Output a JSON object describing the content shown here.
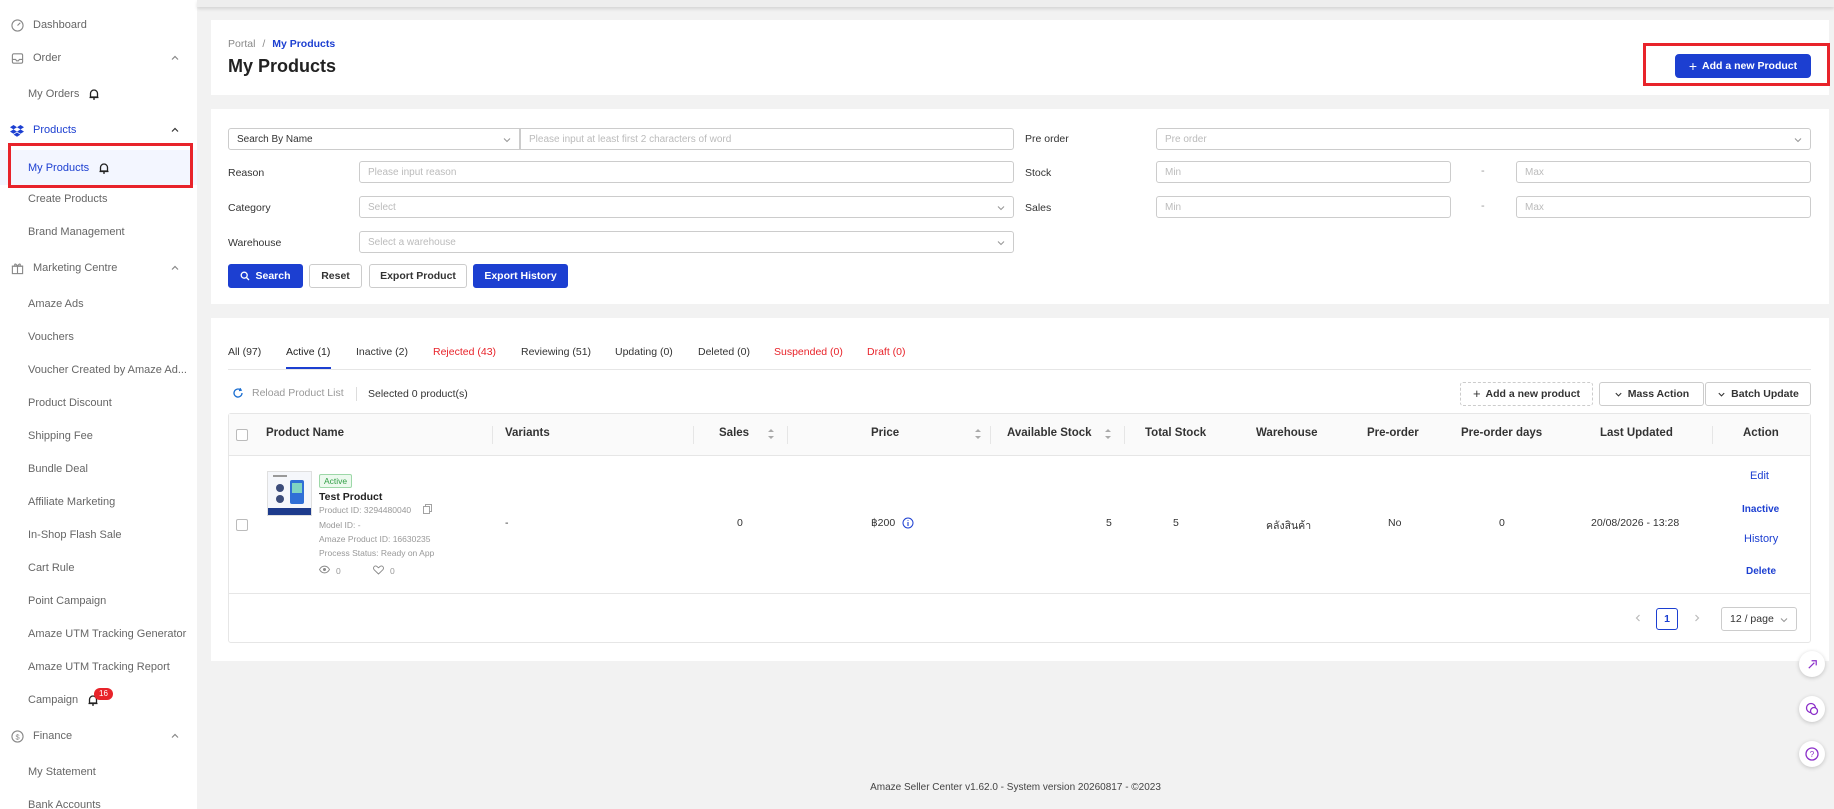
{
  "sidebar": {
    "dashboard": "Dashboard",
    "order": "Order",
    "my_orders": "My Orders",
    "products": "Products",
    "my_products": "My Products",
    "create_products": "Create Products",
    "brand_management": "Brand Management",
    "marketing_centre": "Marketing Centre",
    "marketing_items": [
      "Amaze Ads",
      "Vouchers",
      "Voucher Created by Amaze Ad...",
      "Product Discount",
      "Shipping Fee",
      "Bundle Deal",
      "Affiliate Marketing",
      "In-Shop Flash Sale",
      "Cart Rule",
      "Point Campaign",
      "Amaze UTM Tracking Generator",
      "Amaze UTM Tracking Report"
    ],
    "campaign": "Campaign",
    "campaign_badge": "16",
    "finance": "Finance",
    "my_statement": "My Statement",
    "bank_accounts": "Bank Accounts"
  },
  "header": {
    "breadcrumb_root": "Portal",
    "breadcrumb_sep": "/",
    "breadcrumb_current": "My Products",
    "title": "My Products",
    "add_button": "Add a new Product"
  },
  "filters": {
    "search_by": "Search By Name",
    "search_placeholder": "Please input at least first 2 characters of word",
    "pre_order_label": "Pre order",
    "pre_order_placeholder": "Pre order",
    "reason_label": "Reason",
    "reason_placeholder": "Please input reason",
    "stock_label": "Stock",
    "min_placeholder": "Min",
    "max_placeholder": "Max",
    "range_sep": "-",
    "category_label": "Category",
    "category_placeholder": "Select",
    "sales_label": "Sales",
    "warehouse_label": "Warehouse",
    "warehouse_placeholder": "Select a warehouse",
    "search_button": "Search",
    "reset_button": "Reset",
    "export_product_button": "Export Product",
    "export_history_button": "Export History"
  },
  "tabs": [
    "All (97)",
    "Active (1)",
    "Inactive (2)",
    "Rejected (43)",
    "Reviewing (51)",
    "Updating (0)",
    "Deleted (0)",
    "Suspended (0)",
    "Draft (0)"
  ],
  "toolbar": {
    "reload": "Reload Product List",
    "selected": "Selected 0 product(s)",
    "add_product": "Add a new product",
    "mass_action": "Mass Action",
    "batch_update": "Batch Update"
  },
  "table": {
    "headers": [
      "Product Name",
      "Variants",
      "Sales",
      "Price",
      "Available Stock",
      "Total Stock",
      "Warehouse",
      "Pre-order",
      "Pre-order days",
      "Last Updated",
      "Action"
    ],
    "row": {
      "status": "Active",
      "name": "Test Product",
      "product_id": "Product ID: 3294480040",
      "model_id": "Model ID: -",
      "amaze_id": "Amaze Product ID: 16630235",
      "process_status": "Process Status: Ready on App",
      "views": "0",
      "likes": "0",
      "variants": "-",
      "sales": "0",
      "price": "฿200",
      "available_stock": "5",
      "total_stock": "5",
      "warehouse": "คลังสินค้า",
      "pre_order": "No",
      "pre_order_days": "0",
      "last_updated": "20/08/2026 - 13:28",
      "actions": [
        "Edit",
        "Inactive",
        "History",
        "Delete"
      ]
    }
  },
  "pagination": {
    "current_page": "1",
    "page_size": "12 / page"
  },
  "footer": "Amaze Seller Center v1.62.0 - System version 20260817 - ©2023",
  "colors": {
    "primary": "#1c3fd1",
    "danger": "#e8232a"
  }
}
